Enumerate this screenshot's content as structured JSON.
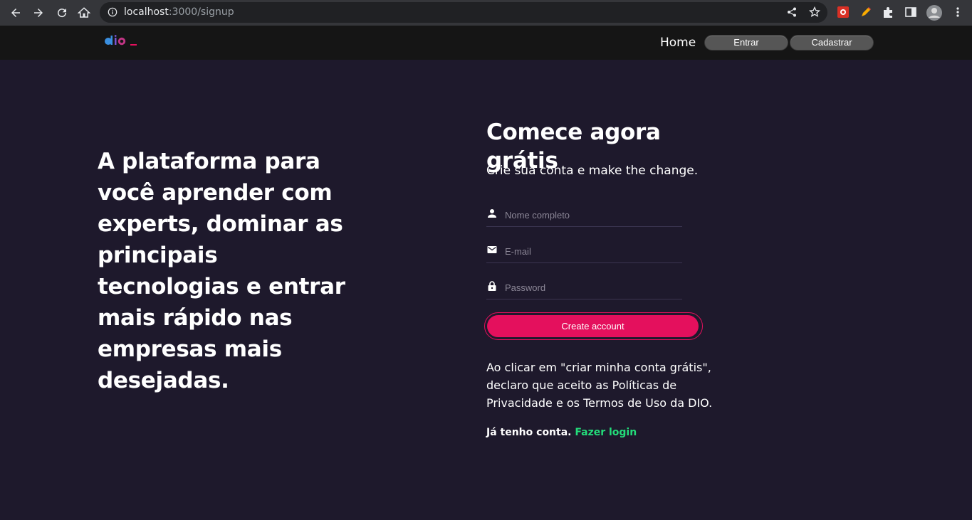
{
  "browser": {
    "url_host": "localhost",
    "url_path": ":3000/signup",
    "icons": [
      "back-icon",
      "forward-icon",
      "reload-icon",
      "home-icon",
      "info-icon",
      "share-icon",
      "star-icon",
      "extension-icon",
      "pen-icon",
      "puzzle-icon",
      "side-panel-icon",
      "profile-avatar",
      "menu-icon"
    ]
  },
  "header": {
    "logo_text": "dio",
    "nav": {
      "home": "Home",
      "login": "Entrar",
      "signup": "Cadastrar"
    }
  },
  "hero": {
    "text": "A plataforma para você aprender com experts, dominar as principais tecnologias e entrar mais rápido nas empresas mais desejadas."
  },
  "form": {
    "title": "Comece agora grátis",
    "subtitle": "Crie sua conta e make the change.",
    "fields": {
      "name_placeholder": "Nome completo",
      "email_placeholder": "E-mail",
      "password_placeholder": "Password"
    },
    "submit_label": "Create account",
    "terms": "Ao clicar em \"criar minha conta grátis\", declaro que aceito as Políticas de Privacidade e os Termos de Uso da DIO.",
    "have_account": "Já tenho conta.",
    "login_link": "Fazer login"
  },
  "colors": {
    "background": "#1e192c",
    "header": "#151515",
    "accent": "#e4105d",
    "link": "#23dd7a"
  }
}
